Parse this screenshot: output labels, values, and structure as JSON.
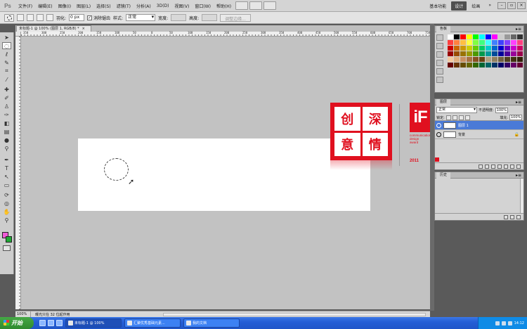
{
  "app": {
    "logo": "Ps"
  },
  "menu": [
    "文件(F)",
    "编辑(E)",
    "图像(I)",
    "图层(L)",
    "选择(S)",
    "滤镜(T)",
    "分析(A)",
    "3D(D)",
    "视图(V)",
    "窗口(W)",
    "帮助(H)"
  ],
  "workspaces": [
    {
      "label": "基本功能",
      "active": false
    },
    {
      "label": "设计",
      "active": true
    },
    {
      "label": "绘画",
      "active": false
    }
  ],
  "workspace_more": "»",
  "window_controls": {
    "minimize": "–",
    "restore": "▫",
    "close": "×"
  },
  "options": {
    "feather_label": "羽化:",
    "feather_value": "0 px",
    "antialias_label": "消除锯齿",
    "antialias_checked": "✓",
    "style_label": "样式:",
    "style_value": "正常",
    "width_label": "宽度:",
    "height_label": "高度:",
    "refine_edge": "调整边缘..."
  },
  "document": {
    "tab_title": "未标题-1 @ 100% (图层 1, RGB/8) *",
    "tab_close": "×",
    "ruler_marks": [
      "350",
      "300",
      "250",
      "200",
      "150",
      "100",
      "50",
      "0",
      "50",
      "100",
      "150",
      "200",
      "250",
      "300",
      "350",
      "400",
      "450",
      "500",
      "550",
      "600",
      "650",
      "700",
      "750"
    ],
    "zoom": "100%",
    "status_info": "曝光只在 32 位起作用"
  },
  "artwork": {
    "seal_chars": [
      "创",
      "深",
      "意",
      "情"
    ],
    "if_logo": "iF",
    "if_lines": [
      "communication",
      "design",
      "award"
    ],
    "if_year": "2011"
  },
  "colors": {
    "foreground": "#f05ad6",
    "background": "#1faa35",
    "seal_red": "#e0101f"
  },
  "panels": {
    "color_tab": "色板",
    "color_menu": "▸≡",
    "layers_tab": "图层",
    "blend_mode": "正常",
    "opacity_label": "不透明度:",
    "opacity_value": "100%",
    "lock_label": "锁定:",
    "fill_label": "填充:",
    "fill_value": "100%",
    "layers": [
      {
        "name": "图层 1",
        "active": true
      },
      {
        "name": "背景",
        "active": false
      }
    ],
    "lock_icon": "🔒",
    "history_tab": "历史",
    "swatches": [
      "#ffffff",
      "#000000",
      "#ff0000",
      "#ffff00",
      "#00ff00",
      "#00ffff",
      "#0000ff",
      "#ff00ff",
      "#cccccc",
      "#999999",
      "#666666",
      "#333333",
      "#ff4040",
      "#ff8040",
      "#ffbf40",
      "#ffff40",
      "#80ff40",
      "#40ff80",
      "#40ffff",
      "#4080ff",
      "#4040ff",
      "#8040ff",
      "#ff40ff",
      "#ff4080",
      "#cc0000",
      "#cc6600",
      "#cc9900",
      "#cccc00",
      "#66cc00",
      "#00cc66",
      "#00cccc",
      "#0066cc",
      "#0000cc",
      "#6600cc",
      "#cc00cc",
      "#cc0066",
      "#990000",
      "#994c00",
      "#997300",
      "#999900",
      "#4c9900",
      "#00994c",
      "#009999",
      "#004c99",
      "#000099",
      "#4c0099",
      "#990099",
      "#99004c",
      "#f2c9a0",
      "#e0b080",
      "#c89060",
      "#a87040",
      "#885020",
      "#684010",
      "#b0a080",
      "#908060",
      "#706040",
      "#504020",
      "#403010",
      "#302008",
      "#660000",
      "#663300",
      "#664d00",
      "#666600",
      "#336600",
      "#006633",
      "#006666",
      "#003366",
      "#000066",
      "#330066",
      "#660066",
      "#660033"
    ]
  },
  "taskbar": {
    "start": "开始",
    "tasks": [
      {
        "label": "未标题-1 @ 100%",
        "active": true
      },
      {
        "label": "汇聚优秀基础元素...",
        "active": false
      },
      {
        "label": "我的文档",
        "active": false
      }
    ],
    "clock": "14:12"
  }
}
